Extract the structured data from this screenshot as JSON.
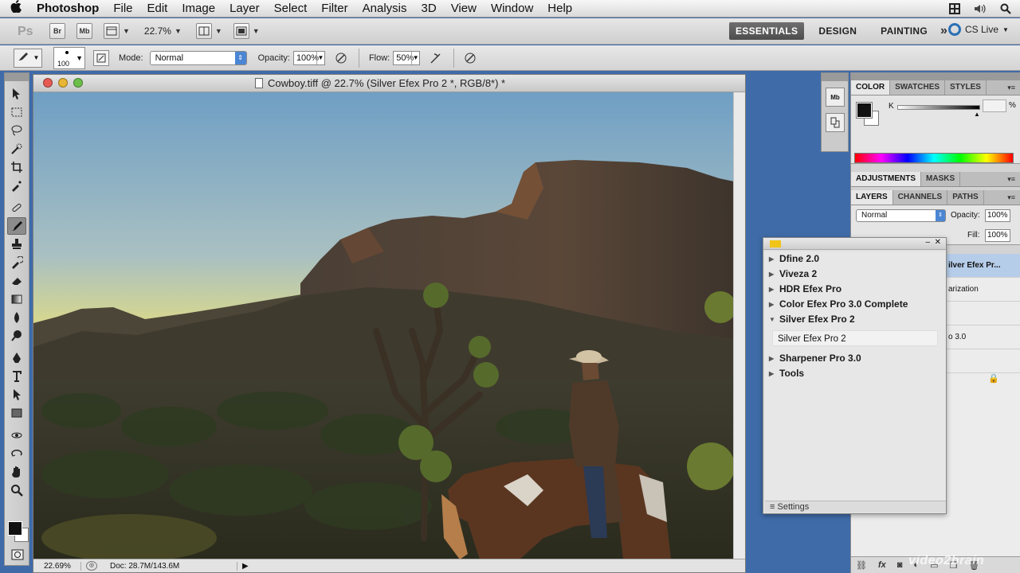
{
  "menubar": {
    "app_name": "Photoshop",
    "items": [
      "File",
      "Edit",
      "Image",
      "Layer",
      "Select",
      "Filter",
      "Analysis",
      "3D",
      "View",
      "Window",
      "Help"
    ]
  },
  "appbar": {
    "bridge_label": "Br",
    "minibridge_label": "Mb",
    "zoom": "22.7%",
    "workspaces": [
      "ESSENTIALS",
      "DESIGN",
      "PAINTING"
    ],
    "active_workspace": "ESSENTIALS",
    "more": "»",
    "cs_live": "CS Live"
  },
  "options": {
    "brush_size": "100",
    "mode_label": "Mode:",
    "mode_value": "Normal",
    "opacity_label": "Opacity:",
    "opacity_value": "100%",
    "flow_label": "Flow:",
    "flow_value": "50%"
  },
  "document": {
    "title": "Cowboy.tiff @ 22.7% (Silver Efex Pro 2 *, RGB/8*) *",
    "status_zoom": "22.69%",
    "status_doc": "Doc: 28.7M/143.6M"
  },
  "color_panel": {
    "tabs": [
      "COLOR",
      "SWATCHES",
      "STYLES"
    ],
    "channel_label": "K",
    "percent": "%"
  },
  "adjust_panel": {
    "tabs": [
      "ADJUSTMENTS",
      "MASKS"
    ]
  },
  "layers_panel": {
    "tabs": [
      "LAYERS",
      "CHANNELS",
      "PATHS"
    ],
    "blend_mode": "Normal",
    "opacity_label": "Opacity:",
    "opacity_value": "100%",
    "fill_label": "Fill:",
    "fill_value": "100%",
    "rows": [
      "ilver Efex Pr...",
      "arization",
      "o 3.0"
    ]
  },
  "nik_panel": {
    "items": [
      "Dfine 2.0",
      "Viveza 2",
      "HDR Efex Pro",
      "Color Efex Pro 3.0 Complete",
      "Silver Efex Pro 2",
      "Sharpener Pro 3.0",
      "Tools"
    ],
    "expanded_item": "Silver Efex Pro 2",
    "sub_item": "Silver Efex Pro 2",
    "settings_label": "Settings"
  },
  "watermark": "video2brain"
}
